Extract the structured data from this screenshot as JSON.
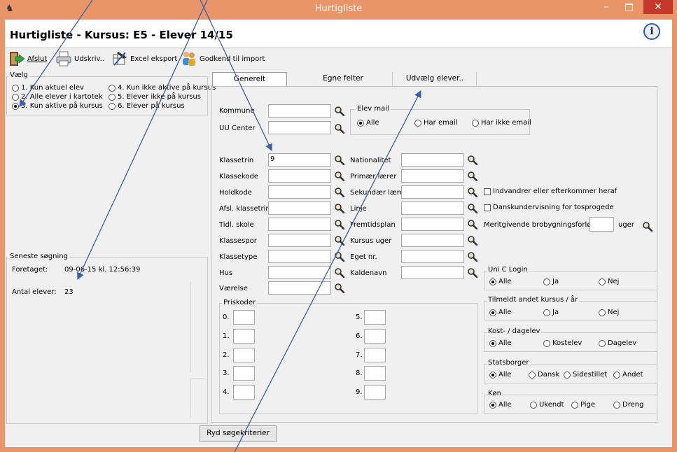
{
  "window": {
    "title": "Hurtigliste"
  },
  "header": {
    "title": "Hurtigliste - Kursus: E5 - Elever 14/15"
  },
  "toolbar": {
    "afslut": "Afslut",
    "udskriv": "Udskriv..",
    "excel": "Excel eksport",
    "godkend": "Godkend til import"
  },
  "vaelg": {
    "title": "Vælg",
    "options": [
      {
        "label": "1. Kun aktuel elev",
        "selected": false
      },
      {
        "label": "2. Alle elever i kartotek",
        "selected": false
      },
      {
        "label": "3. Kun aktive på kursus",
        "selected": true
      },
      {
        "label": "4. Kun ikke aktive på kursus",
        "selected": false
      },
      {
        "label": "5. Elever ikke på kursus",
        "selected": false
      },
      {
        "label": "6. Elever på kursus",
        "selected": false
      }
    ]
  },
  "seneste": {
    "title": "Seneste søgning",
    "foretaget_label": "Foretaget:",
    "foretaget_value": "09-06-15 kl. 12:56:39",
    "antal_label": "Antal elever:",
    "antal_value": "23"
  },
  "tabs": [
    "Generelt",
    "Egne felter",
    "Udvælg elever.."
  ],
  "fields": {
    "kommune": "Kommune",
    "uu_center": "UU Center",
    "klassetrin": "Klassetrin",
    "klassetrin_value": "9",
    "klassekode": "Klassekode",
    "holdkode": "Holdkode",
    "afsl_klassetrin": "Afsl. klassetrin",
    "tidl_skole": "Tidl. skole",
    "klassespor": "Klassespor",
    "klassetype": "Klassetype",
    "hus": "Hus",
    "vaerelse": "Værelse",
    "nationalitet": "Nationalitet",
    "primaer_laerer": "Primær lærer",
    "sekundaer_laerer": "Sekundær lærer",
    "linje": "Linje",
    "fremtidsplan": "Fremtidsplan",
    "kursus_uger": "Kursus uger",
    "eget_nr": "Eget nr.",
    "kaldenavn": "Kaldenavn",
    "indvandrer": "Indvandrer eller efterkommer heraf",
    "danskundervisning": "Danskundervisning for tosprogede",
    "meritgivende": "Meritgivende brobygningsforløb",
    "uger": "uger"
  },
  "elev_mail": {
    "title": "Elev mail",
    "options": [
      "Alle",
      "Har email",
      "Har ikke email"
    ],
    "selected": 0
  },
  "priskoder": {
    "title": "Priskoder",
    "left": [
      "0.",
      "1.",
      "2.",
      "3.",
      "4."
    ],
    "right": [
      "5.",
      "6.",
      "7.",
      "8.",
      "9."
    ]
  },
  "uni_c": {
    "title": "Uni C Login",
    "options": [
      "Alle",
      "Ja",
      "Nej"
    ],
    "selected": 0
  },
  "tilmeldt": {
    "title": "Tilmeldt andet kursus / år",
    "options": [
      "Alle",
      "Ja",
      "Nej"
    ],
    "selected": 0
  },
  "kost": {
    "title": "Kost- / dagelev",
    "options": [
      "Alle",
      "Kostelev",
      "Dagelev"
    ],
    "selected": 0
  },
  "statsborger": {
    "title": "Statsborger",
    "options": [
      "Alle",
      "Dansk",
      "Sidestillet",
      "Andet"
    ],
    "selected": 0
  },
  "koen": {
    "title": "Køn",
    "options": [
      "Alle",
      "Ukendt",
      "Pige",
      "Dreng"
    ],
    "selected": 0
  },
  "buttons": {
    "ryd": "Ryd søgekriterier"
  },
  "colors": {
    "titlebar": "#e8956a",
    "close": "#c7382c",
    "arrow": "#3b5fa8"
  }
}
